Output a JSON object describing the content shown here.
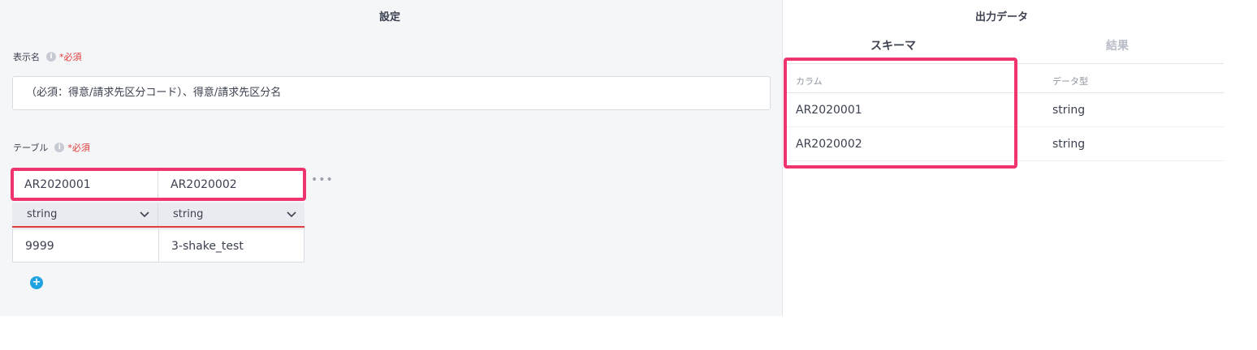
{
  "settings": {
    "title": "設定",
    "display_name_label": "表示名",
    "required_label": "*必須",
    "display_name_value": "（必須：得意/請求先区分コード）、得意/請求先区分名",
    "table_label": "テーブル",
    "table": {
      "columns": [
        {
          "name": "AR2020001",
          "type": "string",
          "value": "9999"
        },
        {
          "name": "AR2020002",
          "type": "string",
          "value": "3-shake_test"
        }
      ]
    }
  },
  "output": {
    "title": "出力データ",
    "tabs": [
      {
        "label": "スキーマ",
        "active": true
      },
      {
        "label": "結果",
        "active": false
      }
    ],
    "schema": {
      "headers": {
        "column": "カラム",
        "type": "データ型"
      },
      "rows": [
        {
          "column": "AR2020001",
          "type": "string"
        },
        {
          "column": "AR2020002",
          "type": "string"
        }
      ]
    }
  },
  "icons": {
    "info": "info-icon",
    "more": "more-icon",
    "add": "add-icon",
    "chevron": "chevron-down-icon"
  },
  "colors": {
    "highlight": "#f0346e",
    "required": "#e03a3a",
    "add_button": "#1fa3e0"
  }
}
